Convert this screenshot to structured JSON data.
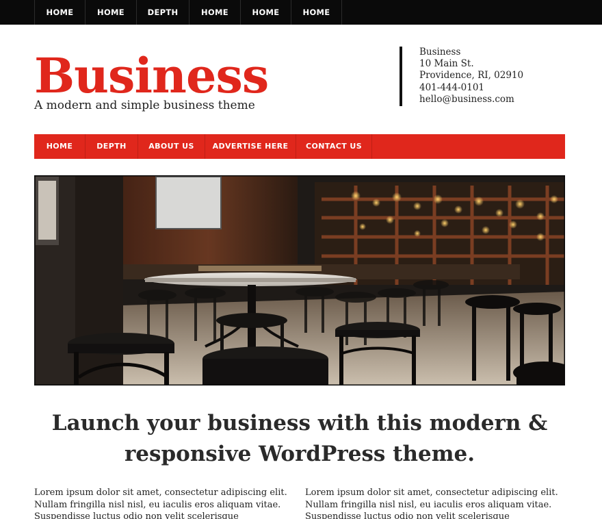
{
  "top_nav": {
    "items": [
      {
        "label": "HOME"
      },
      {
        "label": "HOME"
      },
      {
        "label": "DEPTH"
      },
      {
        "label": "HOME"
      },
      {
        "label": "HOME"
      },
      {
        "label": "HOME"
      }
    ]
  },
  "header": {
    "title": "Business",
    "tagline": "A modern and simple business theme",
    "address": {
      "name": "Business",
      "street": "10 Main St.",
      "city": "Providence, RI, 02910",
      "phone": "401-444-0101",
      "email": "hello@business.com"
    }
  },
  "main_nav": {
    "items": [
      {
        "label": "HOME"
      },
      {
        "label": "DEPTH"
      },
      {
        "label": "ABOUT US"
      },
      {
        "label": "ADVERTISE HERE"
      },
      {
        "label": "CONTACT US"
      }
    ]
  },
  "hero": {
    "image_semantic": "restaurant-interior-photo"
  },
  "content": {
    "headline": "Launch your business with this modern & responsive WordPress theme.",
    "col_left": "Lorem ipsum dolor sit amet, consectetur adipiscing elit. Nullam fringilla nisl nisl, eu iaculis eros aliquam vitae. Suspendisse luctus odio non velit scelerisque",
    "col_right": "Lorem ipsum dolor sit amet, consectetur adipiscing elit. Nullam fringilla nisl nisl, eu iaculis eros aliquam vitae. Suspendisse luctus odio non velit scelerisque"
  },
  "colors": {
    "brand_red": "#e0271c",
    "top_bar": "#0a0a0a",
    "text": "#222222"
  }
}
